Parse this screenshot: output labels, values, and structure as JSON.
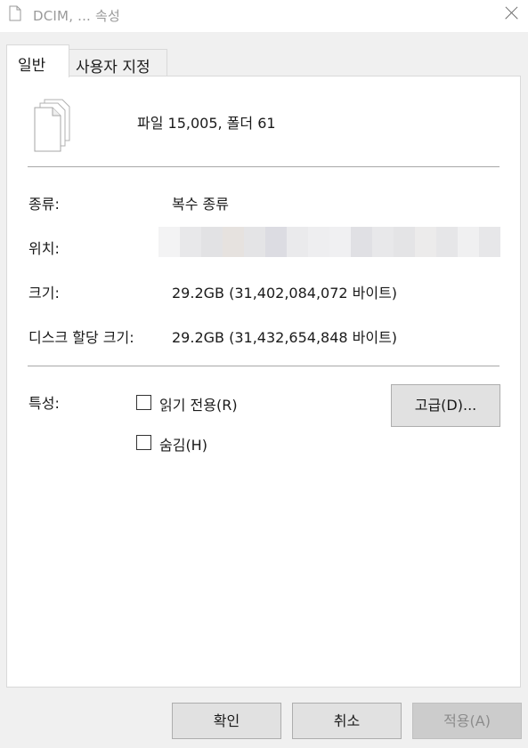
{
  "window": {
    "title": "DCIM, ... 속성"
  },
  "tabs": [
    {
      "label": "일반",
      "selected": true
    },
    {
      "label": "사용자 지정",
      "selected": false
    }
  ],
  "summary": "파일 15,005, 폴더 61",
  "properties": {
    "type_label": "종류:",
    "type_value": "복수 종류",
    "location_label": "위치:",
    "size_label": "크기:",
    "size_value": "29.2GB (31,402,084,072 바이트)",
    "disk_label": "디스크 할당 크기:",
    "disk_value": "29.2GB (31,432,654,848 바이트)"
  },
  "attributes": {
    "label": "특성:",
    "readonly_label": "읽기 전용(R)",
    "readonly_checked": false,
    "hidden_label": "숨김(H)",
    "hidden_checked": false,
    "advanced_button": "고급(D)..."
  },
  "footer": {
    "ok": "확인",
    "cancel": "취소",
    "apply": "적용(A)",
    "apply_enabled": false
  },
  "icons": {
    "title": "document-icon",
    "close": "close-icon",
    "files": "multiple-files-icon"
  }
}
